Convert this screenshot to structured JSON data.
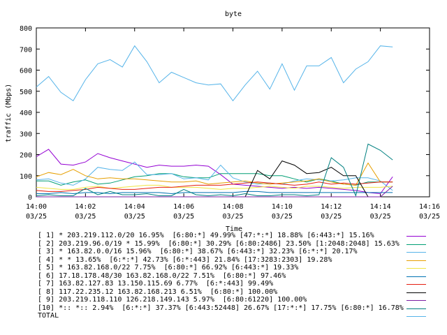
{
  "chart_data": {
    "type": "line",
    "title": "byte",
    "xlabel": "Time",
    "ylabel": "traffic (Mbps)",
    "ylim": [
      0,
      800
    ],
    "yticks": [
      "0",
      "100",
      "200",
      "300",
      "400",
      "500",
      "600",
      "700",
      "800"
    ],
    "xlim_minutes": [
      0,
      16
    ],
    "xticks": [
      {
        "time": "14:00",
        "date": "03/25"
      },
      {
        "time": "14:02",
        "date": "03/25"
      },
      {
        "time": "14:04",
        "date": "03/25"
      },
      {
        "time": "14:06",
        "date": "03/25"
      },
      {
        "time": "14:08",
        "date": "03/25"
      },
      {
        "time": "14:10",
        "date": "03/25"
      },
      {
        "time": "14:12",
        "date": "03/25"
      },
      {
        "time": "14:14",
        "date": "03/25"
      },
      {
        "time": "14:16",
        "date": "03/25"
      }
    ],
    "x_minutes": [
      0,
      0.5,
      1,
      1.5,
      2,
      2.5,
      3,
      3.5,
      4,
      4.5,
      5,
      5.5,
      6,
      6.5,
      7,
      7.5,
      8,
      8.5,
      9,
      9.5,
      10,
      10.5,
      11,
      11.5,
      12,
      12.5,
      13,
      13.5,
      14,
      14.5
    ],
    "grid": false,
    "legend_position": "bottom",
    "series": [
      {
        "legend": "[ 1] * 203.219.112.0/20 16.95%  [6:80:*] 49.99% [47:*:*] 18.88% [6:443:*] 15.16%",
        "color": "#9400d3",
        "values": [
          190,
          225,
          155,
          150,
          165,
          205,
          185,
          170,
          155,
          140,
          150,
          145,
          145,
          150,
          145,
          105,
          60,
          55,
          50,
          45,
          40,
          45,
          40,
          45,
          40,
          35,
          30,
          20,
          15,
          95
        ]
      },
      {
        "legend": "[ 2] 203.219.96.0/19 * 15.99%  [6:80:*] 30.29% [6:80:2486] 23.50% [1:2048:2048] 15.63%",
        "color": "#009e73",
        "values": [
          75,
          75,
          55,
          70,
          80,
          60,
          65,
          80,
          95,
          100,
          110,
          110,
          95,
          90,
          90,
          110,
          110,
          110,
          110,
          100,
          100,
          85,
          70,
          85,
          75,
          60,
          55,
          70,
          70,
          70
        ]
      },
      {
        "legend": "[ 3] * 163.82.0.0/16 15.96%  [6:80:*] 38.67% [6:443:*] 32.23% [6:*:*] 20.17%",
        "color": "#56b4e9",
        "values": [
          80,
          85,
          65,
          55,
          85,
          140,
          130,
          125,
          165,
          105,
          105,
          110,
          85,
          90,
          80,
          150,
          90,
          70,
          60,
          65,
          60,
          75,
          85,
          80,
          75,
          80,
          90,
          90,
          75,
          30
        ]
      },
      {
        "legend": "[ 4] * * 13.65%  [6:*:*] 42.73% [6:*:443] 21.84% [17:3283:2303] 19.28%",
        "color": "#e69f00",
        "values": [
          95,
          115,
          105,
          130,
          100,
          85,
          90,
          85,
          85,
          80,
          75,
          70,
          70,
          75,
          60,
          65,
          70,
          75,
          65,
          60,
          65,
          70,
          75,
          85,
          70,
          60,
          55,
          160,
          70,
          70
        ]
      },
      {
        "legend": "[ 5] * 163.82.168.0/22 7.75%  [6:80:*] 66.92% [6:443:*] 19.33%",
        "color": "#f0e442",
        "values": [
          45,
          40,
          35,
          35,
          45,
          50,
          40,
          45,
          50,
          55,
          55,
          45,
          45,
          45,
          40,
          35,
          40,
          40,
          45,
          50,
          45,
          40,
          50,
          50,
          45,
          40,
          45,
          45,
          45,
          50
        ]
      },
      {
        "legend": "[ 6] 17.18.178.48/30 163.82.168.0/22 7.51%  [6:80:*] 97.46%",
        "color": "#0072b2",
        "values": [
          15,
          15,
          20,
          15,
          20,
          20,
          15,
          20,
          20,
          20,
          20,
          15,
          20,
          20,
          20,
          20,
          20,
          25,
          25,
          20,
          20,
          20,
          20,
          20,
          20,
          20,
          20,
          20,
          20,
          20
        ]
      },
      {
        "legend": "[ 7] 163.82.127.83 13.150.115.69 6.77%  [6:*:443] 99.49%",
        "color": "#e51e10",
        "values": [
          30,
          25,
          25,
          30,
          35,
          45,
          40,
          35,
          35,
          40,
          45,
          45,
          50,
          55,
          55,
          55,
          60,
          65,
          70,
          65,
          60,
          55,
          60,
          70,
          60,
          65,
          60,
          65,
          70,
          70
        ]
      },
      {
        "legend": "[ 8] 117.22.235.12 163.82.168.213 6.51%  [6:80:*] 100.00%",
        "color": "#000000",
        "values": [
          0,
          0,
          0,
          0,
          0,
          0,
          0,
          0,
          0,
          0,
          0,
          0,
          0,
          0,
          0,
          0,
          0,
          0,
          125,
          85,
          170,
          150,
          110,
          115,
          140,
          100,
          100,
          0,
          0,
          0
        ]
      },
      {
        "legend": "[ 9] 203.219.118.110 126.218.149.143 5.97%  [6:80:61220] 100.00%",
        "color": "#7b1fa2",
        "values": [
          0,
          0,
          0,
          0,
          0,
          0,
          0,
          0,
          0,
          0,
          0,
          0,
          0,
          0,
          0,
          0,
          0,
          0,
          0,
          0,
          0,
          0,
          0,
          0,
          0,
          0,
          0,
          0,
          0,
          50
        ]
      },
      {
        "legend": "[10] *:: *:: 2.94%  [6:*:*] 37.37% [6:443:52448] 26.67% [17:*:*] 17.75% [6:80:*] 16.78%",
        "color": "#008080",
        "values": [
          5,
          10,
          5,
          5,
          40,
          10,
          25,
          10,
          10,
          15,
          5,
          5,
          35,
          10,
          5,
          10,
          5,
          15,
          5,
          5,
          10,
          10,
          5,
          10,
          185,
          140,
          5,
          250,
          220,
          175
        ]
      },
      {
        "legend": "TOTAL",
        "color": "#56b4e9",
        "total": true,
        "values": [
          520,
          570,
          495,
          455,
          555,
          630,
          650,
          615,
          715,
          640,
          540,
          590,
          565,
          540,
          530,
          535,
          455,
          530,
          595,
          510,
          630,
          505,
          620,
          620,
          660,
          540,
          605,
          640,
          715,
          710
        ]
      }
    ]
  }
}
